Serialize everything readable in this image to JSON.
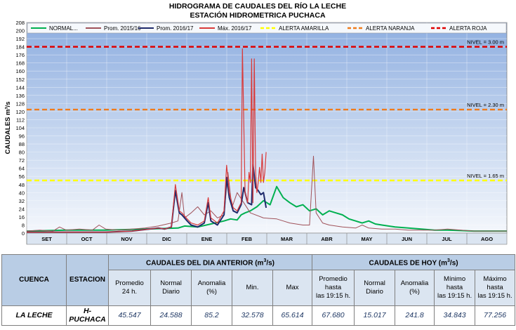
{
  "chart_data": {
    "type": "line",
    "title": "HIDROGRAMA DE CAUDALES DEL RÍO LA LECHE",
    "subtitle": "ESTACIÓN HIDROMETRICA PUCHACA",
    "ylabel": "CAUDALES   m³/s",
    "ylim": [
      0,
      208
    ],
    "yticks": [
      0,
      8,
      16,
      24,
      32,
      40,
      48,
      56,
      64,
      72,
      80,
      88,
      96,
      104,
      112,
      120,
      128,
      136,
      144,
      152,
      160,
      168,
      176,
      184,
      192,
      200,
      208
    ],
    "xlim": [
      0,
      365
    ],
    "months": [
      "SET",
      "OCT",
      "NOV",
      "DIC",
      "ENE",
      "FEB",
      "MAR",
      "ABR",
      "MAY",
      "JUN",
      "JUL",
      "AGO"
    ],
    "legend_position": "top",
    "grid": true,
    "series": [
      {
        "name": "NORMAL...",
        "color": "#00b050",
        "width": 2,
        "x": [
          0,
          30,
          60,
          90,
          115,
          120,
          130,
          140,
          150,
          155,
          160,
          163,
          166,
          170,
          175,
          180,
          185,
          190,
          195,
          200,
          205,
          210,
          215,
          220,
          225,
          230,
          235,
          240,
          245,
          250,
          255,
          260,
          265,
          270,
          275,
          280,
          290,
          300,
          310,
          320,
          330,
          340,
          350,
          365
        ],
        "y": [
          2,
          3,
          3,
          4,
          5,
          7,
          6,
          9,
          12,
          14,
          13,
          18,
          20,
          22,
          26,
          32,
          28,
          46,
          35,
          30,
          26,
          28,
          22,
          24,
          18,
          22,
          20,
          18,
          14,
          12,
          10,
          12,
          9,
          8,
          7,
          6,
          5,
          4,
          3,
          3,
          2.5,
          2,
          2,
          2
        ]
      },
      {
        "name": "Prom. 2015/16",
        "color": "#a0525a",
        "width": 1,
        "x": [
          0,
          10,
          20,
          25,
          30,
          40,
          50,
          55,
          60,
          70,
          80,
          90,
          100,
          110,
          115,
          118,
          120,
          125,
          130,
          135,
          140,
          145,
          150,
          153,
          156,
          160,
          165,
          170,
          180,
          190,
          195,
          200,
          210,
          215,
          218,
          220,
          225,
          230,
          240,
          250,
          255,
          260,
          270,
          280,
          290,
          300,
          310,
          320,
          330,
          340,
          350,
          365
        ],
        "y": [
          2,
          3,
          2,
          6,
          3,
          4,
          3,
          8,
          4,
          3,
          4,
          5,
          7,
          10,
          12,
          40,
          15,
          20,
          26,
          18,
          22,
          15,
          18,
          60,
          25,
          40,
          30,
          20,
          15,
          14,
          12,
          10,
          8,
          8,
          76,
          20,
          10,
          8,
          6,
          5,
          8,
          5,
          4,
          4,
          3,
          3,
          3,
          4,
          3,
          2,
          2,
          2
        ]
      },
      {
        "name": "Prom. 2016/17",
        "color": "#1f2a6b",
        "width": 2,
        "x": [
          0,
          60,
          80,
          100,
          105,
          110,
          113,
          116,
          118,
          122,
          125,
          130,
          135,
          138,
          140,
          145,
          150,
          152,
          154,
          157,
          160,
          163,
          165,
          168,
          171,
          172,
          174,
          176,
          178,
          180,
          182
        ],
        "y": [
          1,
          1,
          2,
          5,
          4,
          6,
          42,
          20,
          18,
          12,
          8,
          6,
          10,
          30,
          12,
          8,
          18,
          55,
          35,
          22,
          20,
          28,
          45,
          30,
          28,
          68,
          45,
          42,
          38,
          40,
          25
        ]
      },
      {
        "name": "Máx. 2016/17",
        "color": "#d93a3a",
        "width": 1.2,
        "x": [
          0,
          60,
          80,
          100,
          105,
          110,
          113,
          116,
          118,
          122,
          125,
          130,
          135,
          138,
          140,
          145,
          150,
          152,
          154,
          157,
          160,
          163,
          164,
          166,
          168,
          169,
          170,
          171,
          172,
          173,
          174,
          175,
          176,
          177,
          178,
          179,
          180,
          181,
          182
        ],
        "y": [
          1,
          1,
          2,
          5,
          4,
          6,
          48,
          22,
          20,
          14,
          10,
          8,
          12,
          35,
          15,
          10,
          22,
          67,
          40,
          25,
          22,
          30,
          182,
          40,
          30,
          60,
          50,
          172,
          30,
          172,
          60,
          40,
          50,
          65,
          50,
          78,
          50,
          60,
          80
        ]
      }
    ],
    "alerts": [
      {
        "name": "ALERTA AMARILLA",
        "value": 52,
        "color": "#ffff00",
        "label": "NIVEL = 1.65 m"
      },
      {
        "name": "ALERTA NARANJA",
        "value": 122,
        "color": "#f07c1c",
        "label": "NIVEL = 2.30 m"
      },
      {
        "name": "ALERTA ROJA",
        "value": 184,
        "color": "#e00000",
        "label": "NIVEL = 3.00 m"
      }
    ]
  },
  "table": {
    "h_cuenca": "CUENCA",
    "h_estacion": "ESTACION",
    "h_anterior": "CAUDALES DEL DIA ANTERIOR (m",
    "h_hoy": "CAUDALES DE HOY (m",
    "h_unit_sup": "3",
    "h_unit_end": "/s)",
    "h_promedio_1": "Promedio",
    "h_promedio_2": "24 h.",
    "h_normal": "Normal Diario",
    "h_anomalia": "Anomalia (%)",
    "h_min": "Min.",
    "h_max": "Max",
    "h_prom_hasta_1": "Promedio hasta",
    "h_prom_hasta_2": "las 19:15 h.",
    "h_normal2": "Normal Diario",
    "h_anomalia2": "Anomalia (%)",
    "h_minimo_1": "Mínimo hasta",
    "h_minimo_2": "las 19:15 h.",
    "h_maximo_1": "Máximo hasta",
    "h_maximo_2": "las 19:15 h.",
    "cuenca": "LA LECHE",
    "estacion": "H-PUCHACA",
    "values": [
      "45.547",
      "24.588",
      "85.2",
      "32.578",
      "65.614",
      "67.680",
      "15.017",
      "241.8",
      "34.843",
      "77.256"
    ]
  }
}
